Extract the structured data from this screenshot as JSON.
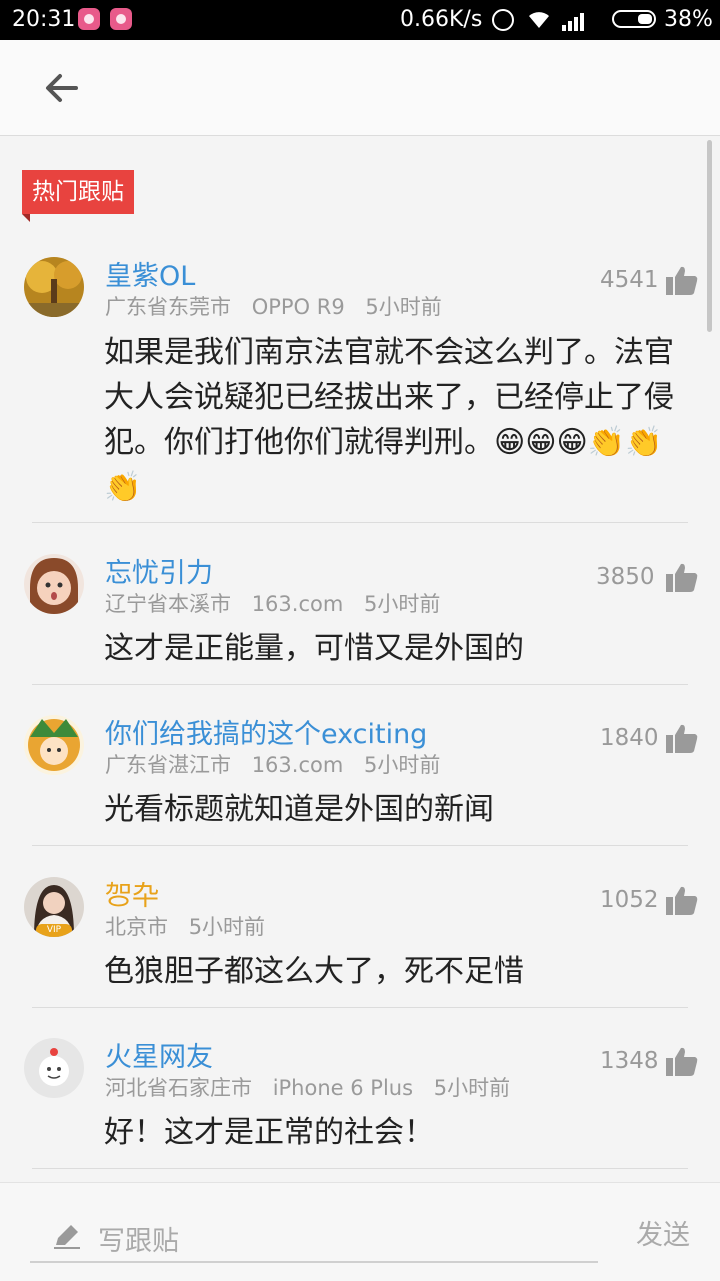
{
  "status": {
    "time": "20:31",
    "speed": "0.66K/s",
    "battery": "38%"
  },
  "header": {
    "back_icon": "arrow-left-icon"
  },
  "section_tag": "热门跟贴",
  "comments": [
    {
      "user": "皇紫OL",
      "user_color": "#3a8fd6",
      "location": "广东省东莞市",
      "device": "OPPO R9",
      "time": "5小时前",
      "likes": "4541",
      "text": "如果是我们南京法官就不会这么判了。法官大人会说疑犯已经拔出来了，已经停止了侵犯。你们打他你们就得判刑。😁😁😁👏👏👏"
    },
    {
      "user": "忘忧引力",
      "user_color": "#3a8fd6",
      "location": "辽宁省本溪市",
      "device": "163.com",
      "time": "5小时前",
      "likes": "3850",
      "text": "这才是正能量，可惜又是外国的"
    },
    {
      "user": "你们给我搞的这个exciting",
      "user_color": "#3a8fd6",
      "location": "广东省湛江市",
      "device": "163.com",
      "time": "5小时前",
      "likes": "1840",
      "text": "光看标题就知道是外国的新闻"
    },
    {
      "user": "㔔卆",
      "user_color": "#e8a21a",
      "location": "北京市",
      "device": "",
      "time": "5小时前",
      "likes": "1052",
      "text": "色狼胆子都这么大了，死不足惜"
    },
    {
      "user": "火星网友",
      "user_color": "#3a8fd6",
      "location": "河北省石家庄市",
      "device": "iPhone 6 Plus",
      "time": "5小时前",
      "likes": "1348",
      "text": "好！这才是正常的社会！"
    }
  ],
  "avatar_badge": "VIP",
  "compose": {
    "placeholder": "写跟贴",
    "send_label": "发送"
  }
}
